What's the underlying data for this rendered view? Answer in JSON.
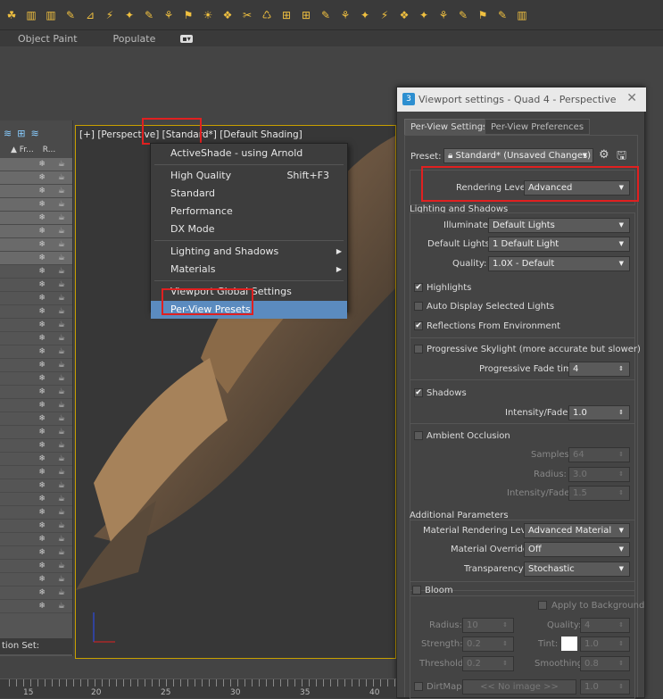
{
  "ribbon": {
    "items": [
      "Object Paint",
      "Populate"
    ]
  },
  "scene_explorer": {
    "col1": "▲ Fr...",
    "col2": "R...",
    "footer": "tion Set:"
  },
  "viewport": {
    "label": "[+] [Perspective] [Standard*] [Default Shading]"
  },
  "menu": {
    "items": [
      {
        "label": "ActiveShade - using Arnold"
      },
      {
        "label": "High Quality",
        "shortcut": "Shift+F3"
      },
      {
        "label": "Standard"
      },
      {
        "label": "Performance"
      },
      {
        "label": "DX Mode"
      },
      {
        "label": "Lighting and Shadows"
      },
      {
        "label": "Materials"
      },
      {
        "label": "Viewport Global Settings"
      },
      {
        "label": "Per-View Presets"
      }
    ]
  },
  "dialog": {
    "title": "Viewport settings - Quad 4 - Perspective",
    "tabs": [
      "Per-View Settings",
      "Per-View Preferences"
    ],
    "preset_label": "Preset:",
    "preset_value": "Standard* (Unsaved Changes)",
    "rendering_level_label": "Rendering Level:",
    "rendering_level_value": "Advanced",
    "lighting_section": "Lighting and Shadows",
    "illuminate_label": "Illuminate:",
    "illuminate_value": "Default Lights",
    "default_lights_label": "Default Lights:",
    "default_lights_value": "1 Default Light",
    "quality_label": "Quality:",
    "quality_value": "1.0X - Default",
    "highlights": "Highlights",
    "auto_display": "Auto Display Selected Lights",
    "reflections": "Reflections From Environment",
    "progressive_skylight": "Progressive Skylight (more accurate but slower)",
    "fade_time_label": "Progressive Fade time:",
    "fade_time_value": "4",
    "shadows": "Shadows",
    "intensity_label": "Intensity/Fade:",
    "intensity_value": "1.0",
    "ambient_occlusion": "Ambient Occlusion",
    "samples_label": "Samples:",
    "samples_value": "64",
    "radius_label": "Radius:",
    "radius_value": "3.0",
    "ao_intensity_label": "Intensity/Fade:",
    "ao_intensity_value": "1.5",
    "additional_section": "Additional Parameters",
    "mat_render_label": "Material Rendering Level:",
    "mat_render_value": "Advanced Material",
    "mat_override_label": "Material Override:",
    "mat_override_value": "Off",
    "transparency_label": "Transparency:",
    "transparency_value": "Stochastic",
    "bloom": "Bloom",
    "apply_bg": "Apply to Background",
    "b_radius_label": "Radius:",
    "b_radius_value": "10",
    "b_quality_label": "Quality:",
    "b_quality_value": "4",
    "b_strength_label": "Strength:",
    "b_strength_value": "0.2",
    "b_tint_label": "Tint:",
    "b_tint_value": "1.0",
    "b_threshold_label": "Threshold:",
    "b_threshold_value": "0.2",
    "b_smoothing_label": "Smoothing:",
    "b_smoothing_value": "0.8",
    "dirtmap": "DirtMap",
    "dirtmap_value": "<< No image >>",
    "dirtmap_num": "1.0"
  },
  "ruler": {
    "numbers": [
      "15",
      "20",
      "25",
      "30",
      "35",
      "40",
      "50"
    ]
  }
}
